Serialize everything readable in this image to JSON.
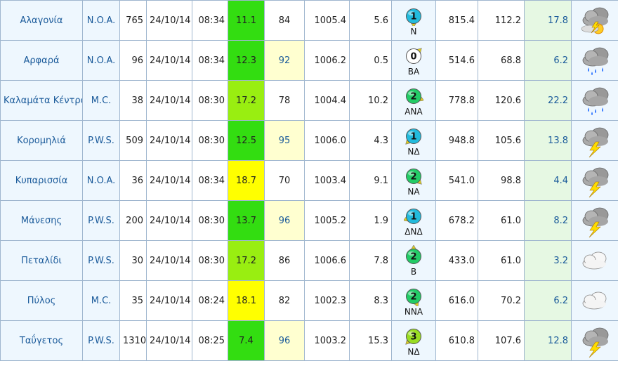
{
  "colors": {
    "temp_green": "#33dd11",
    "temp_lime": "#99ee11",
    "temp_yellow": "#ffff00",
    "humidity_highlight": "#ffffd0",
    "link_blue": "#1a5a9a",
    "rain_bg": "#e6f8e3"
  },
  "rows": [
    {
      "name": "Αλαγονία",
      "network": "N.O.A.",
      "altitude": "765",
      "date": "24/10/14",
      "time": "08:34",
      "temp": "11.1",
      "temp_color": "#33dd11",
      "humidity": "84",
      "humidity_high": false,
      "pressure": "1005.4",
      "wind_speed": "5.6",
      "beaufort": "1",
      "wind_dir": "Ν",
      "wind_color": "#22bbdd",
      "col1": "815.4",
      "col2": "112.2",
      "rain": "17.8",
      "weather_icon": "storm-sun-icon"
    },
    {
      "name": "Αρφαρά",
      "network": "N.O.A.",
      "altitude": "96",
      "date": "24/10/14",
      "time": "08:34",
      "temp": "12.3",
      "temp_color": "#33dd11",
      "humidity": "92",
      "humidity_high": true,
      "pressure": "1006.2",
      "wind_speed": "0.5",
      "beaufort": "0",
      "wind_dir": "ΒΑ",
      "wind_color": "#ffffff",
      "col1": "514.6",
      "col2": "68.8",
      "rain": "6.2",
      "weather_icon": "rain-cloud-icon"
    },
    {
      "name": "Καλαμάτα Κέντρο",
      "network": "M.C.",
      "altitude": "38",
      "date": "24/10/14",
      "time": "08:30",
      "temp": "17.2",
      "temp_color": "#99ee11",
      "humidity": "78",
      "humidity_high": false,
      "pressure": "1004.4",
      "wind_speed": "10.2",
      "beaufort": "2",
      "wind_dir": "ΑΝΑ",
      "wind_color": "#22cc66",
      "col1": "778.8",
      "col2": "120.6",
      "rain": "22.2",
      "weather_icon": "rain-cloud-icon"
    },
    {
      "name": "Κορομηλιά",
      "network": "P.W.S.",
      "altitude": "509",
      "date": "24/10/14",
      "time": "08:30",
      "temp": "12.5",
      "temp_color": "#33dd11",
      "humidity": "95",
      "humidity_high": true,
      "pressure": "1006.0",
      "wind_speed": "4.3",
      "beaufort": "1",
      "wind_dir": "ΝΔ",
      "wind_color": "#22bbdd",
      "col1": "948.8",
      "col2": "105.6",
      "rain": "13.8",
      "weather_icon": "thunderstorm-icon"
    },
    {
      "name": "Κυπαρισσία",
      "network": "N.O.A.",
      "altitude": "36",
      "date": "24/10/14",
      "time": "08:34",
      "temp": "18.7",
      "temp_color": "#ffff00",
      "humidity": "70",
      "humidity_high": false,
      "pressure": "1003.4",
      "wind_speed": "9.1",
      "beaufort": "2",
      "wind_dir": "ΝΑ",
      "wind_color": "#22cc66",
      "col1": "541.0",
      "col2": "98.8",
      "rain": "4.4",
      "weather_icon": "thunderstorm-icon"
    },
    {
      "name": "Μάνεσης",
      "network": "P.W.S.",
      "altitude": "200",
      "date": "24/10/14",
      "time": "08:30",
      "temp": "13.7",
      "temp_color": "#33dd11",
      "humidity": "96",
      "humidity_high": true,
      "pressure": "1005.2",
      "wind_speed": "1.9",
      "beaufort": "1",
      "wind_dir": "ΔΝΔ",
      "wind_color": "#22bbdd",
      "col1": "678.2",
      "col2": "61.0",
      "rain": "8.2",
      "weather_icon": "thunderstorm-icon"
    },
    {
      "name": "Πεταλίδι",
      "network": "P.W.S.",
      "altitude": "30",
      "date": "24/10/14",
      "time": "08:30",
      "temp": "17.2",
      "temp_color": "#99ee11",
      "humidity": "86",
      "humidity_high": false,
      "pressure": "1006.6",
      "wind_speed": "7.8",
      "beaufort": "2",
      "wind_dir": "Β",
      "wind_color": "#22cc66",
      "col1": "433.0",
      "col2": "61.0",
      "rain": "3.2",
      "weather_icon": "cloud-icon"
    },
    {
      "name": "Πύλος",
      "network": "M.C.",
      "altitude": "35",
      "date": "24/10/14",
      "time": "08:24",
      "temp": "18.1",
      "temp_color": "#ffff00",
      "humidity": "82",
      "humidity_high": false,
      "pressure": "1002.3",
      "wind_speed": "8.3",
      "beaufort": "2",
      "wind_dir": "ΝΝΑ",
      "wind_color": "#22cc66",
      "col1": "616.0",
      "col2": "70.2",
      "rain": "6.2",
      "weather_icon": "cloud-icon"
    },
    {
      "name": "Ταΰγετος",
      "network": "P.W.S.",
      "altitude": "1310",
      "date": "24/10/14",
      "time": "08:25",
      "temp": "7.4",
      "temp_color": "#33dd11",
      "humidity": "96",
      "humidity_high": true,
      "pressure": "1003.2",
      "wind_speed": "15.3",
      "beaufort": "3",
      "wind_dir": "ΝΔ",
      "wind_color": "#99dd22",
      "col1": "610.8",
      "col2": "107.6",
      "rain": "12.8",
      "weather_icon": "thunderstorm-icon"
    }
  ]
}
